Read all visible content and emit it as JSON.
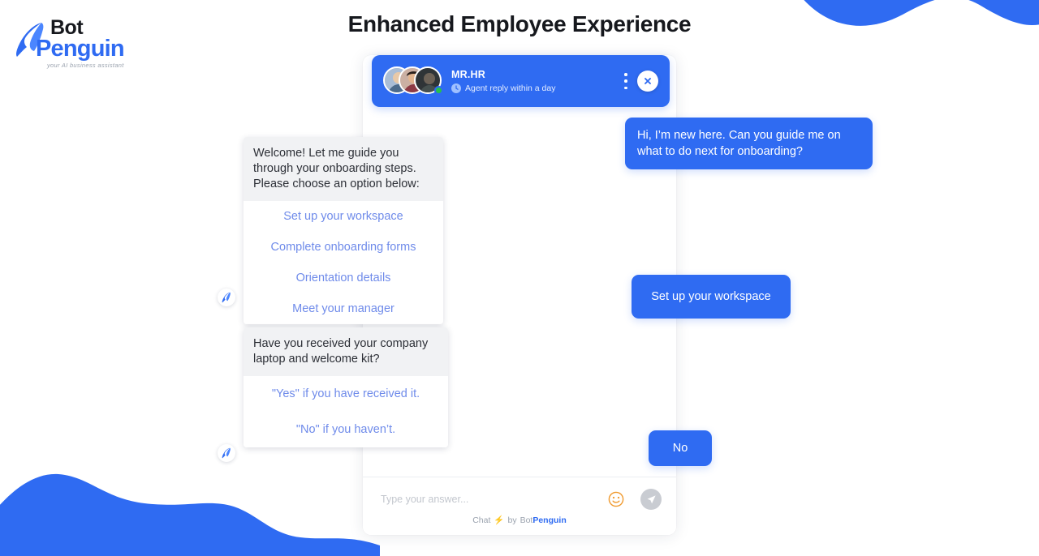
{
  "brand": {
    "logo_top": "Bot",
    "logo_bottom": "Penguin",
    "tagline": "your AI business assistant",
    "accent_blue": "#2f6bf2",
    "option_blue": "#6f8bea",
    "dark_text": "#16181d"
  },
  "page": {
    "title": "Enhanced Employee Experience"
  },
  "chat_header": {
    "title": "MR.HR",
    "status": "Agent reply within a day",
    "clock_icon": "clock-icon",
    "menu_icon": "kebab-menu-icon",
    "close_icon": "close-icon",
    "online_indicator": "online-status-dot",
    "avatar_count": 3
  },
  "messages": [
    {
      "id": "m1",
      "role": "bot",
      "type": "card",
      "text": "Welcome! Let me guide you through your onboarding steps. Please choose an option below:",
      "options": [
        "Set up your workspace",
        "Complete onboarding forms",
        "Orientation details",
        "Meet your manager"
      ]
    },
    {
      "id": "m2",
      "role": "user",
      "type": "bubble",
      "text": "Hi, I’m new here. Can you guide me on what to do next for onboarding?"
    },
    {
      "id": "m3",
      "role": "user",
      "type": "bubble",
      "text": "Set up your workspace"
    },
    {
      "id": "m4",
      "role": "bot",
      "type": "card",
      "text": "Have you received your company laptop and welcome kit?",
      "options": [
        "\"Yes\" if you have received it.",
        "\"No\" if you haven’t."
      ]
    },
    {
      "id": "m5",
      "role": "user",
      "type": "bubble",
      "text": "No"
    }
  ],
  "composer": {
    "placeholder": "Type your answer...",
    "value": "",
    "emoji_icon": "emoji-smiley-icon",
    "send_icon": "send-paper-plane-icon",
    "footer_prefix": "Chat",
    "footer_bolt": "⚡",
    "footer_by": "by",
    "footer_brand_first": "Bot",
    "footer_brand_second": "Penguin"
  }
}
